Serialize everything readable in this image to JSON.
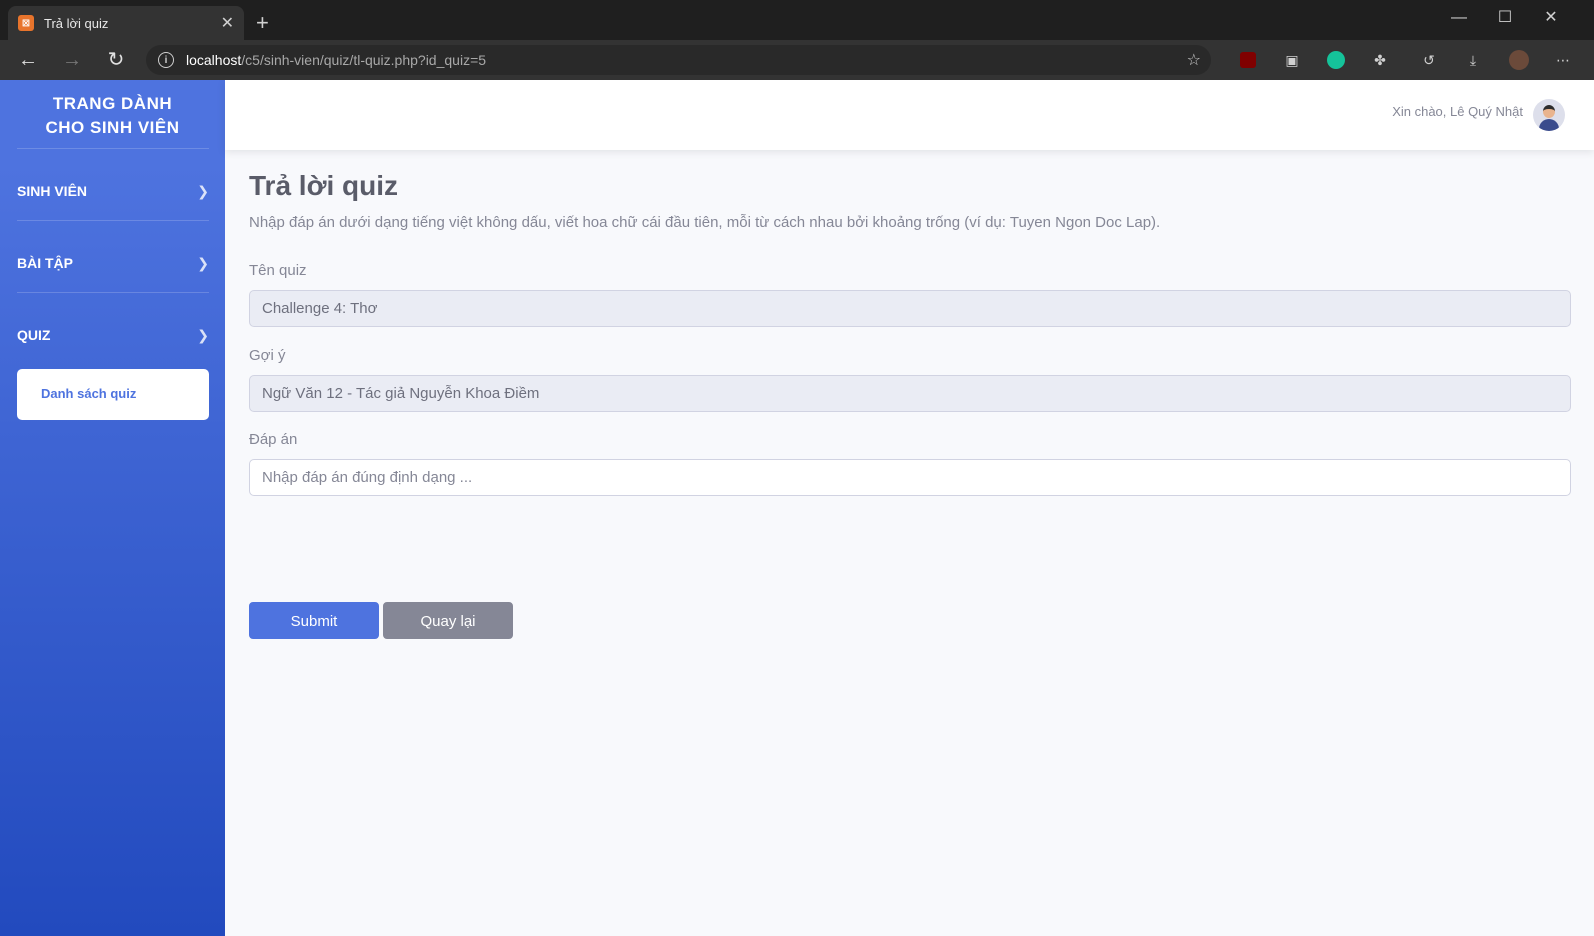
{
  "browser": {
    "tab_title": "Trả lời quiz",
    "url_host": "localhost",
    "url_path": "/c5/sinh-vien/quiz/tl-quiz.php?id_quiz=5",
    "icons": [
      "back-icon",
      "forward-icon",
      "reload-icon",
      "info-icon",
      "favorite-icon",
      "ublock-icon",
      "collections-icon",
      "grammarly-icon",
      "extensions-icon",
      "history-icon",
      "download-icon",
      "profile-icon",
      "more-icon"
    ]
  },
  "sidebar": {
    "brand_line1": "TRANG DÀNH",
    "brand_line2": "CHO SINH VIÊN",
    "items": [
      {
        "label": "SINH VIÊN"
      },
      {
        "label": "BÀI TẬP"
      },
      {
        "label": "QUIZ"
      }
    ],
    "quiz_sub_item": "Danh sách quiz",
    "colors": {
      "gradient_top": "#4e73df",
      "gradient_bottom": "#224abe"
    }
  },
  "topbar": {
    "greeting": "Xin chào, Lê Quý Nhật"
  },
  "main": {
    "title": "Trả lời quiz",
    "instruction": "Nhập đáp án dưới dạng tiếng việt không dấu, viết hoa chữ cái đầu tiên, mỗi từ cách nhau bởi khoảng trống (ví dụ: Tuyen Ngon Doc Lap).",
    "quiz_name_label": "Tên quiz",
    "quiz_name_value": "Challenge 4: Thơ",
    "hint_label": "Gợi ý",
    "hint_value": "Ngữ Văn 12 - Tác giả Nguyễn Khoa Điềm",
    "answer_label": "Đáp án",
    "answer_value": "",
    "answer_placeholder": "Nhập đáp án đúng định dạng ...",
    "submit_label": "Submit",
    "back_label": "Quay lại",
    "colors": {
      "primary": "#4e73df",
      "secondary": "#858796"
    }
  }
}
